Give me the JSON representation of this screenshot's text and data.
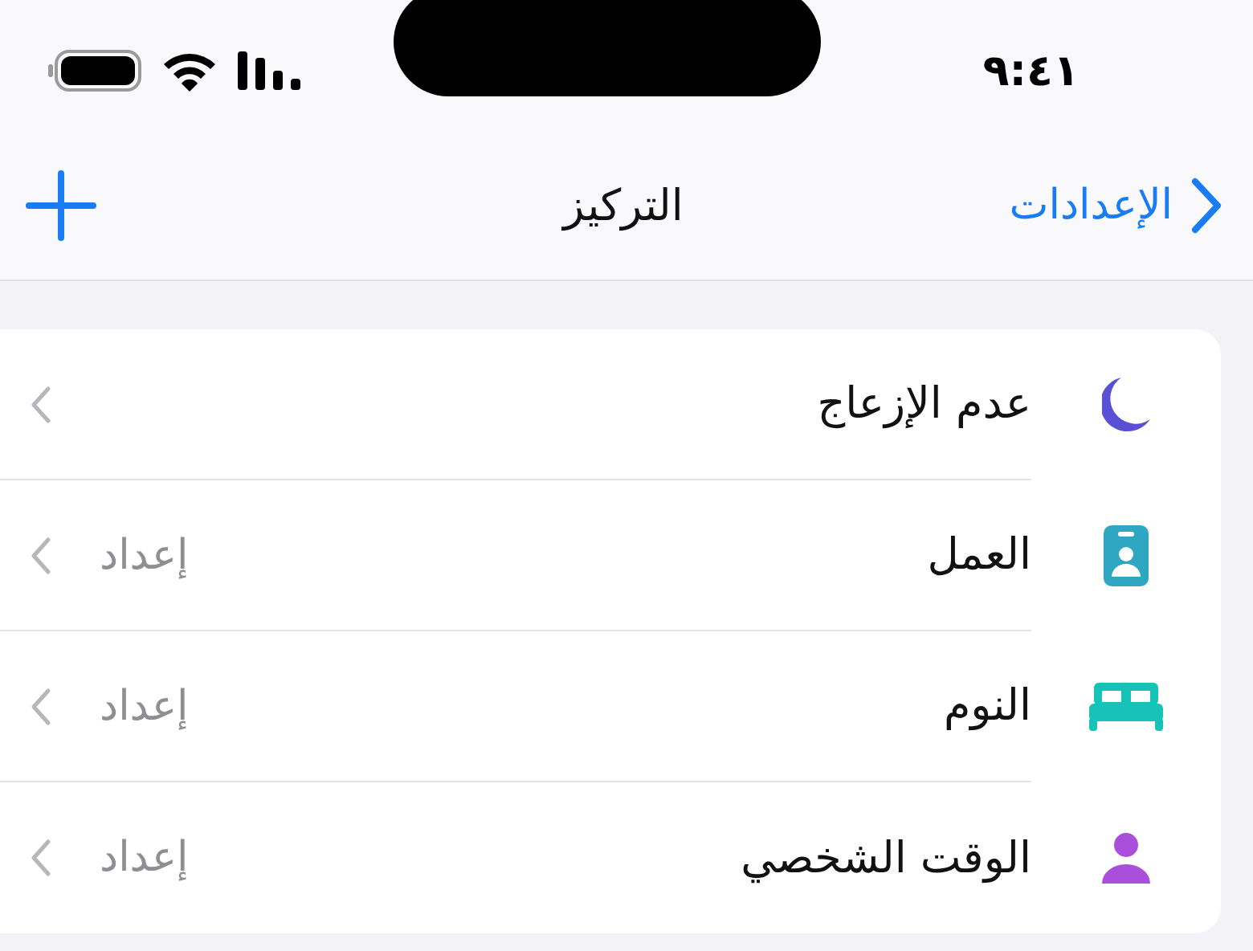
{
  "status_bar": {
    "time": "٩:٤١"
  },
  "nav": {
    "back": "الإعدادات",
    "title": "التركيز"
  },
  "focus_items": [
    {
      "kind": "moon",
      "label": "عدم الإزعاج",
      "color": "#5a50d6"
    },
    {
      "kind": "badge",
      "label": "العمل",
      "detail": "إعداد",
      "color": "#2fa7c2"
    },
    {
      "kind": "bed",
      "label": "النوم",
      "detail": "إعداد",
      "color": "#17c3b8"
    },
    {
      "kind": "person",
      "label": "الوقت الشخصي",
      "detail": "إعداد",
      "color": "#a94fdc"
    }
  ]
}
